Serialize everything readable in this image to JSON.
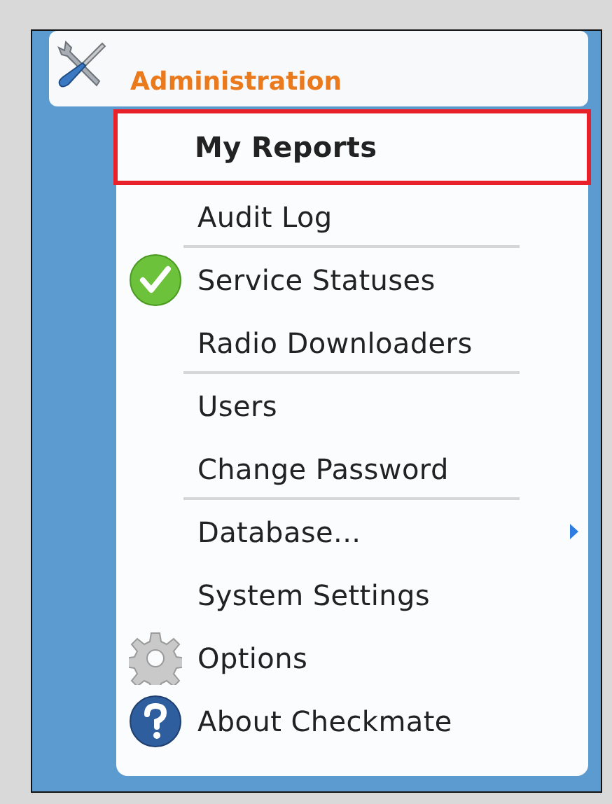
{
  "menu": {
    "title": "Administration",
    "items": [
      {
        "label": "My Reports",
        "kind": "plain",
        "selected": true,
        "separator_after": false,
        "submenu": false
      },
      {
        "label": "Audit Log",
        "kind": "plain",
        "selected": false,
        "separator_after": true,
        "submenu": false
      },
      {
        "label": "Service Statuses",
        "kind": "status",
        "selected": false,
        "separator_after": false,
        "submenu": false
      },
      {
        "label": "Radio Downloaders",
        "kind": "plain",
        "selected": false,
        "separator_after": true,
        "submenu": false
      },
      {
        "label": "Users",
        "kind": "plain",
        "selected": false,
        "separator_after": false,
        "submenu": false
      },
      {
        "label": "Change Password",
        "kind": "plain",
        "selected": false,
        "separator_after": true,
        "submenu": false
      },
      {
        "label": "Database...",
        "kind": "plain",
        "selected": false,
        "separator_after": false,
        "submenu": true
      },
      {
        "label": "System Settings",
        "kind": "plain",
        "selected": false,
        "separator_after": false,
        "submenu": false
      },
      {
        "label": "Options",
        "kind": "options",
        "selected": false,
        "separator_after": false,
        "submenu": false
      },
      {
        "label": "About Checkmate",
        "kind": "about",
        "selected": false,
        "separator_after": false,
        "submenu": false
      }
    ]
  }
}
